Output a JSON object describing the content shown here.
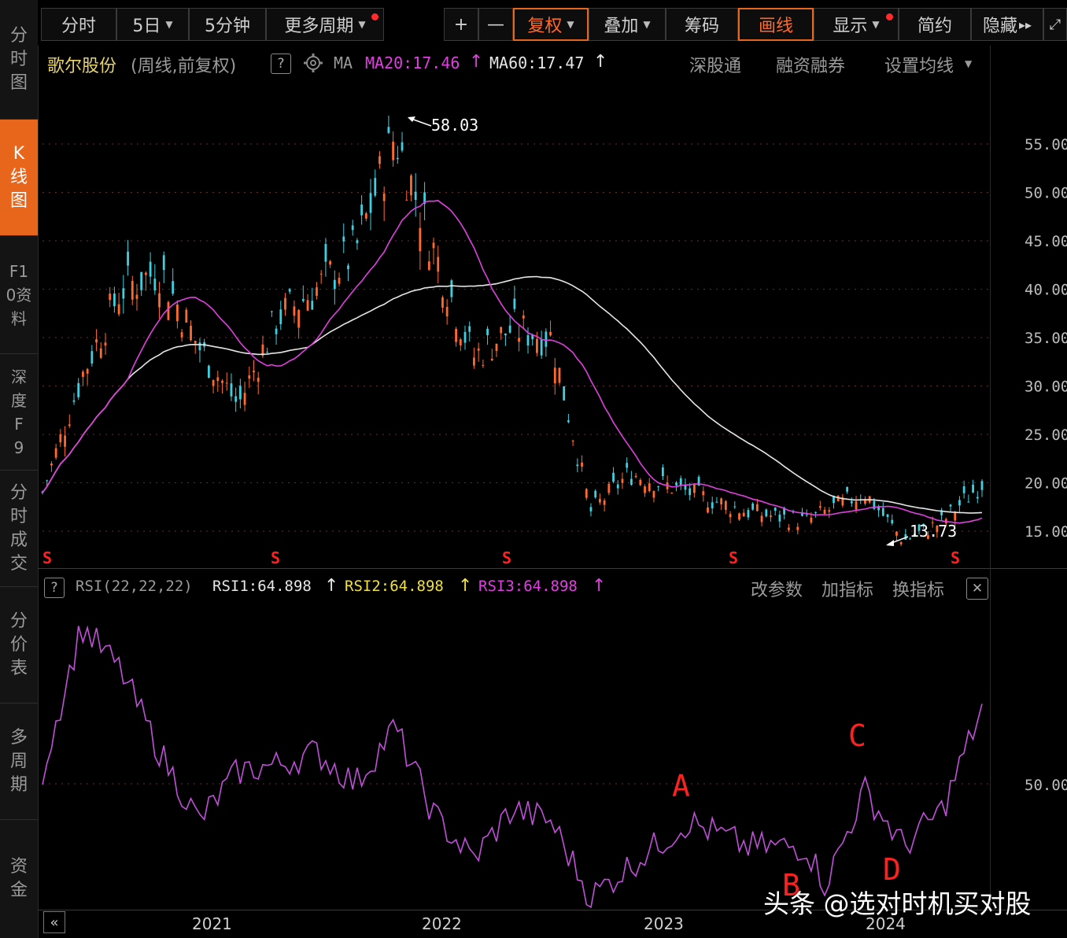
{
  "sidebar": {
    "tabs": [
      {
        "label": "分时图",
        "active": false
      },
      {
        "label": "K线图",
        "active": true
      },
      {
        "label": "F10资料",
        "active": false
      },
      {
        "label": "深度F9",
        "active": false
      },
      {
        "label": "分时成交",
        "active": false
      },
      {
        "label": "分价表",
        "active": false
      },
      {
        "label": "多周期",
        "active": false
      },
      {
        "label": "资金",
        "active": false
      }
    ]
  },
  "toolbar": {
    "buttons": [
      "分时",
      "5日",
      "5分钟",
      "更多周期",
      "+",
      "—",
      "复权",
      "叠加",
      "筹码",
      "画线",
      "显示",
      "简约",
      "隐藏"
    ],
    "hidden_glyph": "▸▸",
    "expand_glyph": "⤢"
  },
  "info": {
    "stock_name": "歌尔股份",
    "period": "(周线,前复权)",
    "ma_label": "MA",
    "ma20": "MA20:17.46",
    "ma60": "MA60:17.47",
    "links": [
      "深股通",
      "融资融券",
      "设置均线"
    ],
    "help": "?",
    "up_arrow": "↑"
  },
  "price_axis": {
    "labels": [
      "55.00",
      "50.00",
      "45.00",
      "40.00",
      "35.00",
      "30.00",
      "25.00",
      "20.00",
      "15.00"
    ]
  },
  "annotations": {
    "high": "58.03",
    "low": "13.73",
    "s_marker": "S"
  },
  "rsi": {
    "title": "RSI(22,22,22)",
    "rsi1": "RSI1:64.898",
    "rsi2": "RSI2:64.898",
    "rsi3": "RSI3:64.898",
    "actions": [
      "改参数",
      "加指标",
      "换指标"
    ],
    "close": "✕",
    "axis_label": "50.00",
    "markers": [
      "A",
      "B",
      "C",
      "D"
    ]
  },
  "time_axis": {
    "labels": [
      "2021",
      "2022",
      "2023",
      "2024"
    ],
    "nav": "«"
  },
  "watermark": "头条 @选对时机买对股",
  "colors": {
    "up": "#ff6a30",
    "down": "#3fd0e0",
    "ma20": "#e040e0",
    "ma60": "#e6e6e6",
    "rsi": "#c050d8",
    "accent": "#e8661c",
    "marker": "#ff2020"
  },
  "chart_data": {
    "type": "line",
    "title": "歌尔股份",
    "ylim": [
      13,
      60
    ],
    "x_labels": [
      "2021",
      "2022",
      "2023",
      "2024"
    ],
    "price_points": [
      {
        "x": "2020-06",
        "y": 19
      },
      {
        "x": "2020-08",
        "y": 31
      },
      {
        "x": "2020-10",
        "y": 40
      },
      {
        "x": "2020-12",
        "y": 42
      },
      {
        "x": "2021-02",
        "y": 34
      },
      {
        "x": "2021-04",
        "y": 28
      },
      {
        "x": "2021-06",
        "y": 37
      },
      {
        "x": "2021-08",
        "y": 40
      },
      {
        "x": "2021-10",
        "y": 44
      },
      {
        "x": "2021-12",
        "y": 56
      },
      {
        "x": "2022-02",
        "y": 44
      },
      {
        "x": "2022-04",
        "y": 33
      },
      {
        "x": "2022-06",
        "y": 36
      },
      {
        "x": "2022-08",
        "y": 35
      },
      {
        "x": "2022-10",
        "y": 17
      },
      {
        "x": "2022-12",
        "y": 21
      },
      {
        "x": "2023-03",
        "y": 19
      },
      {
        "x": "2023-06",
        "y": 17
      },
      {
        "x": "2023-09",
        "y": 16
      },
      {
        "x": "2023-12",
        "y": 19
      },
      {
        "x": "2024-02",
        "y": 14
      },
      {
        "x": "2024-04",
        "y": 16
      },
      {
        "x": "2024-06",
        "y": 20
      }
    ],
    "ma20": "MA20:17.46",
    "ma60": "MA60:17.47",
    "high": 58.03,
    "low": 13.73,
    "rsi_points": [
      {
        "x": "2020-06",
        "y": 52
      },
      {
        "x": "2020-08",
        "y": 75
      },
      {
        "x": "2020-10",
        "y": 68
      },
      {
        "x": "2020-12",
        "y": 55
      },
      {
        "x": "2021-02",
        "y": 44
      },
      {
        "x": "2021-04",
        "y": 52
      },
      {
        "x": "2021-06",
        "y": 53
      },
      {
        "x": "2021-08",
        "y": 55
      },
      {
        "x": "2021-10",
        "y": 50
      },
      {
        "x": "2021-12",
        "y": 59
      },
      {
        "x": "2022-02",
        "y": 45
      },
      {
        "x": "2022-04",
        "y": 38
      },
      {
        "x": "2022-06",
        "y": 46
      },
      {
        "x": "2022-08",
        "y": 44
      },
      {
        "x": "2022-10",
        "y": 32
      },
      {
        "x": "2022-12",
        "y": 37
      },
      {
        "x": "2023-03",
        "y": 44
      },
      {
        "x": "2023-06",
        "y": 40
      },
      {
        "x": "2023-09",
        "y": 40
      },
      {
        "x": "2023-10",
        "y": 34
      },
      {
        "x": "2023-12",
        "y": 49
      },
      {
        "x": "2024-02",
        "y": 40
      },
      {
        "x": "2024-04",
        "y": 46
      },
      {
        "x": "2024-06",
        "y": 62
      }
    ]
  }
}
